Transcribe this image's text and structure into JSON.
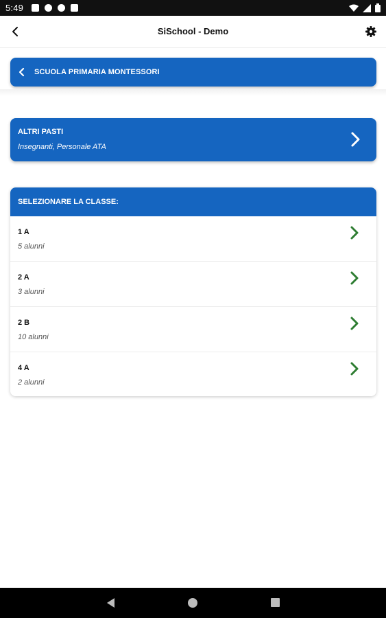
{
  "status_bar": {
    "time": "5:49",
    "icons": [
      "notification-icon",
      "notification-icon",
      "flipboard-icon",
      "sd-card-icon",
      "wifi-icon",
      "signal-icon",
      "battery-icon"
    ]
  },
  "app_bar": {
    "title": "SiSchool - Demo",
    "back_icon": "back-arrow-icon",
    "settings_icon": "gear-icon"
  },
  "school": {
    "name": "SCUOLA PRIMARIA MONTESSORI"
  },
  "altri_pasti": {
    "title": "ALTRI PASTI",
    "subtitle": "Insegnanti, Personale ATA"
  },
  "class_list": {
    "header": "SELEZIONARE LA CLASSE:",
    "items": [
      {
        "name": "1 A",
        "count": "5 alunni"
      },
      {
        "name": "2 A",
        "count": "3 alunni"
      },
      {
        "name": "2 B",
        "count": "10 alunni"
      },
      {
        "name": "4 A",
        "count": "2 alunni"
      }
    ]
  },
  "colors": {
    "primary": "#1565c0",
    "accent_green": "#2e7d32",
    "status_bar": "#111111",
    "nav_bar": "#000000"
  }
}
